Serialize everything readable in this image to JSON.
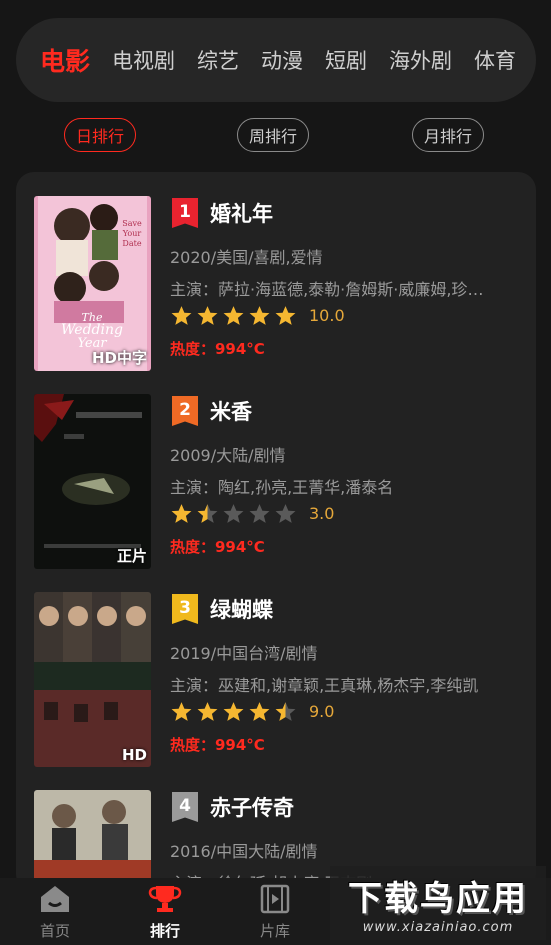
{
  "categories": [
    "电影",
    "电视剧",
    "综艺",
    "动漫",
    "短剧",
    "海外剧",
    "体育"
  ],
  "active_category": 0,
  "rank_tabs": [
    "日排行",
    "周排行",
    "月排行"
  ],
  "active_rank_tab": 0,
  "movies": [
    {
      "rank": "1",
      "badge_color": "#e8232f",
      "title": "婚礼年",
      "meta": "2020/美国/喜剧,爱情",
      "cast": "主演：萨拉·海蓝德,泰勒·詹姆斯·威廉姆,珍妮·恩赛",
      "rating": 10.0,
      "score": "10.0",
      "heat": "热度：994°C",
      "quality": "HD中字"
    },
    {
      "rank": "2",
      "badge_color": "#ef6a25",
      "title": "米香",
      "meta": "2009/大陆/剧情",
      "cast": "主演：陶红,孙亮,王菁华,潘泰名",
      "rating": 3.0,
      "score": "3.0",
      "heat": "热度：994°C",
      "quality": "正片"
    },
    {
      "rank": "3",
      "badge_color": "#f0b91d",
      "title": "绿蝴蝶",
      "meta": "2019/中国台湾/剧情",
      "cast": "主演：巫建和,谢章颖,王真琳,杨杰宇,李纯凯",
      "rating": 9.0,
      "score": "9.0",
      "heat": "热度：994°C",
      "quality": "HD"
    },
    {
      "rank": "4",
      "badge_color": "#9a9a9a",
      "title": "赤子传奇",
      "meta": "2016/中国大陆/剧情",
      "cast": "主演：徐尔延,胡小庭,王志刚",
      "rating": 0,
      "score": "",
      "heat": "",
      "quality": ""
    }
  ],
  "nav": [
    {
      "label": "首页",
      "icon": "home-icon"
    },
    {
      "label": "排行",
      "icon": "trophy-icon"
    },
    {
      "label": "片库",
      "icon": "film-icon"
    }
  ],
  "active_nav": 1,
  "watermark": {
    "big": "下载鸟应用",
    "small": "www.xiazainiao.com"
  },
  "colors": {
    "accent": "#ff2a1f",
    "star": "#f5b731",
    "star_empty": "#5a5a5a",
    "score": "#e6a83a"
  }
}
